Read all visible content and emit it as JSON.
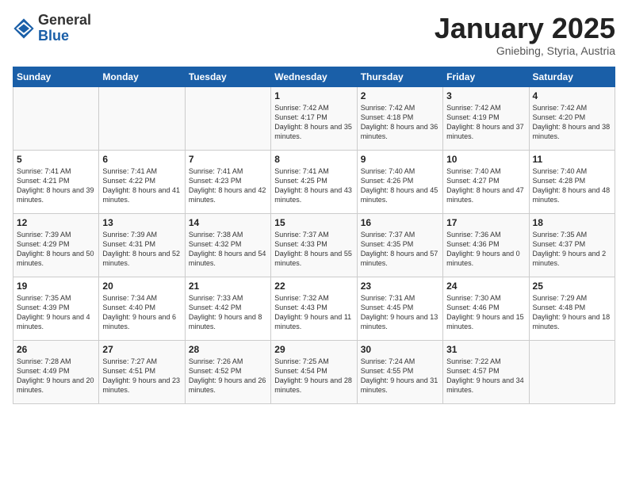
{
  "logo": {
    "general": "General",
    "blue": "Blue"
  },
  "title": "January 2025",
  "subtitle": "Gniebing, Styria, Austria",
  "days_of_week": [
    "Sunday",
    "Monday",
    "Tuesday",
    "Wednesday",
    "Thursday",
    "Friday",
    "Saturday"
  ],
  "weeks": [
    [
      {
        "day": "",
        "content": ""
      },
      {
        "day": "",
        "content": ""
      },
      {
        "day": "",
        "content": ""
      },
      {
        "day": "1",
        "content": "Sunrise: 7:42 AM\nSunset: 4:17 PM\nDaylight: 8 hours and 35 minutes."
      },
      {
        "day": "2",
        "content": "Sunrise: 7:42 AM\nSunset: 4:18 PM\nDaylight: 8 hours and 36 minutes."
      },
      {
        "day": "3",
        "content": "Sunrise: 7:42 AM\nSunset: 4:19 PM\nDaylight: 8 hours and 37 minutes."
      },
      {
        "day": "4",
        "content": "Sunrise: 7:42 AM\nSunset: 4:20 PM\nDaylight: 8 hours and 38 minutes."
      }
    ],
    [
      {
        "day": "5",
        "content": "Sunrise: 7:41 AM\nSunset: 4:21 PM\nDaylight: 8 hours and 39 minutes."
      },
      {
        "day": "6",
        "content": "Sunrise: 7:41 AM\nSunset: 4:22 PM\nDaylight: 8 hours and 41 minutes."
      },
      {
        "day": "7",
        "content": "Sunrise: 7:41 AM\nSunset: 4:23 PM\nDaylight: 8 hours and 42 minutes."
      },
      {
        "day": "8",
        "content": "Sunrise: 7:41 AM\nSunset: 4:25 PM\nDaylight: 8 hours and 43 minutes."
      },
      {
        "day": "9",
        "content": "Sunrise: 7:40 AM\nSunset: 4:26 PM\nDaylight: 8 hours and 45 minutes."
      },
      {
        "day": "10",
        "content": "Sunrise: 7:40 AM\nSunset: 4:27 PM\nDaylight: 8 hours and 47 minutes."
      },
      {
        "day": "11",
        "content": "Sunrise: 7:40 AM\nSunset: 4:28 PM\nDaylight: 8 hours and 48 minutes."
      }
    ],
    [
      {
        "day": "12",
        "content": "Sunrise: 7:39 AM\nSunset: 4:29 PM\nDaylight: 8 hours and 50 minutes."
      },
      {
        "day": "13",
        "content": "Sunrise: 7:39 AM\nSunset: 4:31 PM\nDaylight: 8 hours and 52 minutes."
      },
      {
        "day": "14",
        "content": "Sunrise: 7:38 AM\nSunset: 4:32 PM\nDaylight: 8 hours and 54 minutes."
      },
      {
        "day": "15",
        "content": "Sunrise: 7:37 AM\nSunset: 4:33 PM\nDaylight: 8 hours and 55 minutes."
      },
      {
        "day": "16",
        "content": "Sunrise: 7:37 AM\nSunset: 4:35 PM\nDaylight: 8 hours and 57 minutes."
      },
      {
        "day": "17",
        "content": "Sunrise: 7:36 AM\nSunset: 4:36 PM\nDaylight: 9 hours and 0 minutes."
      },
      {
        "day": "18",
        "content": "Sunrise: 7:35 AM\nSunset: 4:37 PM\nDaylight: 9 hours and 2 minutes."
      }
    ],
    [
      {
        "day": "19",
        "content": "Sunrise: 7:35 AM\nSunset: 4:39 PM\nDaylight: 9 hours and 4 minutes."
      },
      {
        "day": "20",
        "content": "Sunrise: 7:34 AM\nSunset: 4:40 PM\nDaylight: 9 hours and 6 minutes."
      },
      {
        "day": "21",
        "content": "Sunrise: 7:33 AM\nSunset: 4:42 PM\nDaylight: 9 hours and 8 minutes."
      },
      {
        "day": "22",
        "content": "Sunrise: 7:32 AM\nSunset: 4:43 PM\nDaylight: 9 hours and 11 minutes."
      },
      {
        "day": "23",
        "content": "Sunrise: 7:31 AM\nSunset: 4:45 PM\nDaylight: 9 hours and 13 minutes."
      },
      {
        "day": "24",
        "content": "Sunrise: 7:30 AM\nSunset: 4:46 PM\nDaylight: 9 hours and 15 minutes."
      },
      {
        "day": "25",
        "content": "Sunrise: 7:29 AM\nSunset: 4:48 PM\nDaylight: 9 hours and 18 minutes."
      }
    ],
    [
      {
        "day": "26",
        "content": "Sunrise: 7:28 AM\nSunset: 4:49 PM\nDaylight: 9 hours and 20 minutes."
      },
      {
        "day": "27",
        "content": "Sunrise: 7:27 AM\nSunset: 4:51 PM\nDaylight: 9 hours and 23 minutes."
      },
      {
        "day": "28",
        "content": "Sunrise: 7:26 AM\nSunset: 4:52 PM\nDaylight: 9 hours and 26 minutes."
      },
      {
        "day": "29",
        "content": "Sunrise: 7:25 AM\nSunset: 4:54 PM\nDaylight: 9 hours and 28 minutes."
      },
      {
        "day": "30",
        "content": "Sunrise: 7:24 AM\nSunset: 4:55 PM\nDaylight: 9 hours and 31 minutes."
      },
      {
        "day": "31",
        "content": "Sunrise: 7:22 AM\nSunset: 4:57 PM\nDaylight: 9 hours and 34 minutes."
      },
      {
        "day": "",
        "content": ""
      }
    ]
  ]
}
